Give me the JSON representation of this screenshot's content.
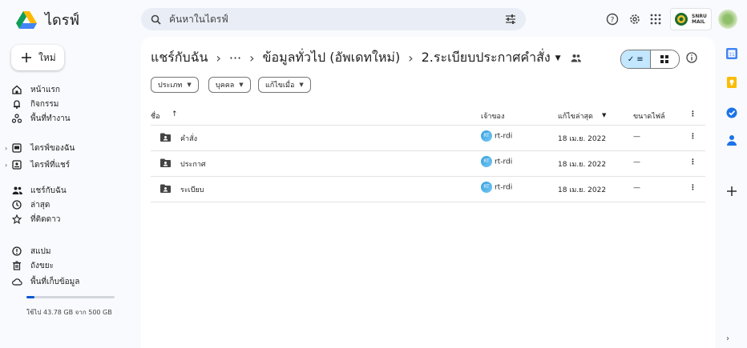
{
  "app": {
    "title": "ไดรฟ์"
  },
  "search": {
    "placeholder": "ค้นหาในไดรฟ์"
  },
  "account": {
    "line1": "SNRU",
    "line2": "MAIL"
  },
  "sidebar": {
    "new_label": "ใหม่",
    "items": [
      {
        "label": "หน้าแรก",
        "icon": "home-icon"
      },
      {
        "label": "กิจกรรม",
        "icon": "bell-icon"
      },
      {
        "label": "พื้นที่ทำงาน",
        "icon": "workspaces-icon"
      },
      {
        "label": "ไดรฟ์ของฉัน",
        "icon": "my-drive-icon"
      },
      {
        "label": "ไดรฟ์ที่แชร์",
        "icon": "shared-drives-icon"
      },
      {
        "label": "แชร์กับฉัน",
        "icon": "shared-with-me-icon"
      },
      {
        "label": "ล่าสุด",
        "icon": "clock-icon"
      },
      {
        "label": "ที่ติดดาว",
        "icon": "star-icon"
      },
      {
        "label": "สแปม",
        "icon": "spam-icon"
      },
      {
        "label": "ถังขยะ",
        "icon": "trash-icon"
      },
      {
        "label": "พื้นที่เก็บข้อมูล",
        "icon": "cloud-icon"
      }
    ],
    "storage_text": "ใช้ไป 43.78 GB จาก 500 GB",
    "storage_fraction": 0.0876
  },
  "breadcrumb": {
    "root": "แชร์กับฉัน",
    "ellipsis": "···",
    "parent": "ข้อมูลทั่วไป (อัพเดทใหม่)",
    "current": "2.ระเบียบประกาศคำสั่ง"
  },
  "filters": [
    "ประเภท",
    "บุคคล",
    "แก้ไขเมื่อ"
  ],
  "table": {
    "headers": {
      "name": "ชื่อ",
      "owner": "เจ้าของ",
      "modified": "แก้ไขล่าสุด",
      "size": "ขนาดไฟล์"
    },
    "rows": [
      {
        "name": "คำสั่ง",
        "owner": "rt-rdi",
        "modified": "18 เม.ย. 2022",
        "size": "—"
      },
      {
        "name": "ประกาศ",
        "owner": "rt-rdi",
        "modified": "18 เม.ย. 2022",
        "size": "—"
      },
      {
        "name": "ระเบียบ",
        "owner": "rt-rdi",
        "modified": "18 เม.ย. 2022",
        "size": "—"
      }
    ]
  },
  "colors": {
    "accent": "#0b57d0",
    "selected_toggle": "#c2e7ff",
    "background": "#f8fafd"
  }
}
